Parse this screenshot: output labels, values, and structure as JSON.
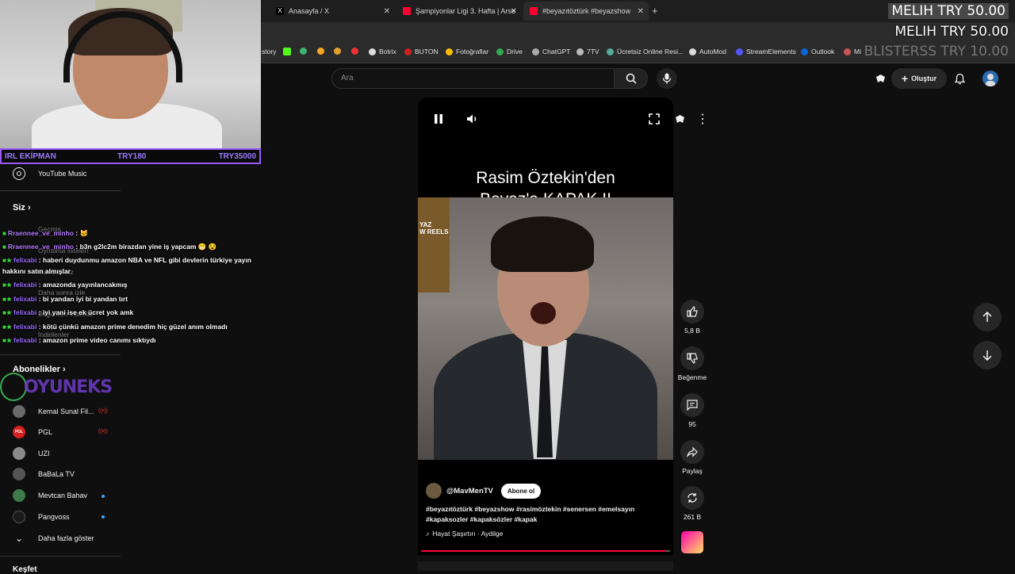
{
  "browser": {
    "tabs": [
      {
        "label": "Anasayfa / X",
        "icon": "x-logo-icon"
      },
      {
        "label": "Şampiyonlar Ligi 3. Hafta | Arse",
        "icon": "youtube-icon"
      },
      {
        "label": "#beyazıtöztürk #beyazshow",
        "icon": "youtube-icon"
      }
    ],
    "new_tab": "+",
    "bookmarks": [
      "story",
      "Botrix",
      "BUTON",
      "Fotoğraflar",
      "Drive",
      "ChatGPT",
      "7TV",
      "Ücretsiz Online Resi...",
      "AutoMod",
      "StreamElements",
      "Outlook",
      "Mi"
    ]
  },
  "overlay": {
    "donations": [
      "MELIH  TRY 50.00",
      "MELIH  TRY 50.00",
      "BLISTERSS  TRY 10.00"
    ],
    "ekip": {
      "left": "IRL EKİPMAN",
      "mid": "TRY180",
      "right": "TRY35000"
    },
    "brand": "OYUNEKS",
    "chat": [
      {
        "user": "Rraennee_ve_minho",
        "msg": ": 🐱"
      },
      {
        "user": "Rraennee_ve_minho",
        "msg": ": b3n g2lc2m birazdan yine iş yapcam 😁 😵"
      },
      {
        "user": "felixabi",
        "msg": ": haberi duydunmu amazon NBA ve NFL gibi devlerin türkiye yayın"
      },
      {
        "user": "",
        "msg": "hakkını satın almışlar"
      },
      {
        "user": "felixabi",
        "msg": ": amazonda yayınlancakmış"
      },
      {
        "user": "felixabi",
        "msg": ": bi yandan iyi bi yandan tırt"
      },
      {
        "user": "felixabi",
        "msg": ": iyi yani ise ek ücret yok amk"
      },
      {
        "user": "felixabi",
        "msg": ": kötü çünkü amazon prime denedim hiç güzel anım olmadı"
      },
      {
        "user": "felixabi",
        "msg": ": amazon prime video canımı sıktıydı"
      }
    ]
  },
  "sidebar": {
    "youtube_music": "YouTube Music",
    "you_heading": "Siz",
    "ghost_items": [
      "Geçmiş",
      "Oynatma listeleri",
      "Videolarınız",
      "Daha sonra izle",
      "Beğenilen videolar",
      "İndirilenler"
    ],
    "subs_heading": "Abonelikler",
    "channels": [
      {
        "name": "Kemal Sunal Fil...",
        "status": "live"
      },
      {
        "name": "PGL",
        "status": "live"
      },
      {
        "name": "UZI",
        "status": ""
      },
      {
        "name": "BaBaLa TV",
        "status": ""
      },
      {
        "name": "Mevtcan Bahav",
        "status": "new"
      },
      {
        "name": "Pangvoss",
        "status": "new"
      }
    ],
    "show_more": "Daha fazla göster",
    "explore_heading": "Keşfet",
    "colors": {
      "live": "#e33333",
      "new": "#3ea6ff"
    }
  },
  "header": {
    "search_placeholder": "Ara",
    "create_label": "Oluştur"
  },
  "short": {
    "title_line1": "Rasim Öztekin'den",
    "title_line2": "Beyaz'a KAPAK !!",
    "overlay_text": "YAZ\nW REELS",
    "channel": "@MavMenTV",
    "subscribe": "Abone ol",
    "tags_line1": "#beyazıtöztürk #beyazshow #rasimöztekin #senersen #emelsayın",
    "tags_line2": "#kapaksozler #kapaksözler #kapak",
    "song": "Hayat Şaşırtırı · Aydilge",
    "progress": 0.98
  },
  "actions": {
    "likes": "5,8 B",
    "dislike": "Beğenme",
    "comments": "95",
    "share": "Paylaş",
    "remix": "261 B"
  }
}
